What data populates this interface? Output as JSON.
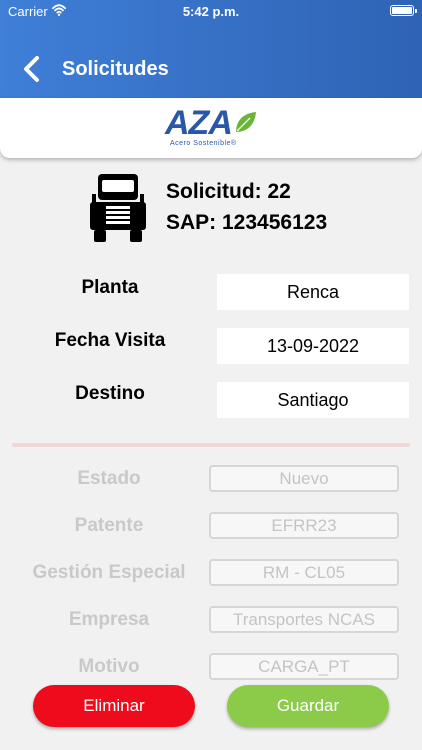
{
  "status_bar": {
    "carrier": "Carrier",
    "time": "5:42 p.m."
  },
  "header": {
    "title": "Solicitudes",
    "back_icon": "chevron-left-icon"
  },
  "logo": {
    "name": "AZA",
    "tagline": "Acero Sostenible®"
  },
  "request": {
    "number_text": "Solicitud: 22",
    "sap_text": "SAP: 123456123",
    "icon": "truck-icon"
  },
  "fields": [
    {
      "label": "Planta",
      "value": "Renca"
    },
    {
      "label": "Fecha Visita",
      "value": "13-09-2022"
    },
    {
      "label": "Destino",
      "value": "Santiago"
    }
  ],
  "disabled_fields": [
    {
      "label": "Estado",
      "value": "Nuevo"
    },
    {
      "label": "Patente",
      "value": "EFRR23"
    },
    {
      "label": "Gestión Especial",
      "value": "RM - CL05"
    },
    {
      "label": "Empresa",
      "value": "Transportes NCAS"
    },
    {
      "label": "Motivo",
      "value": "CARGA_PT"
    }
  ],
  "actions": {
    "delete_label": "Eliminar",
    "save_label": "Guardar"
  },
  "colors": {
    "header": "#3f7fd8",
    "delete": "#ee0b1c",
    "save": "#8ccb4a",
    "brand": "#2a57a8"
  }
}
